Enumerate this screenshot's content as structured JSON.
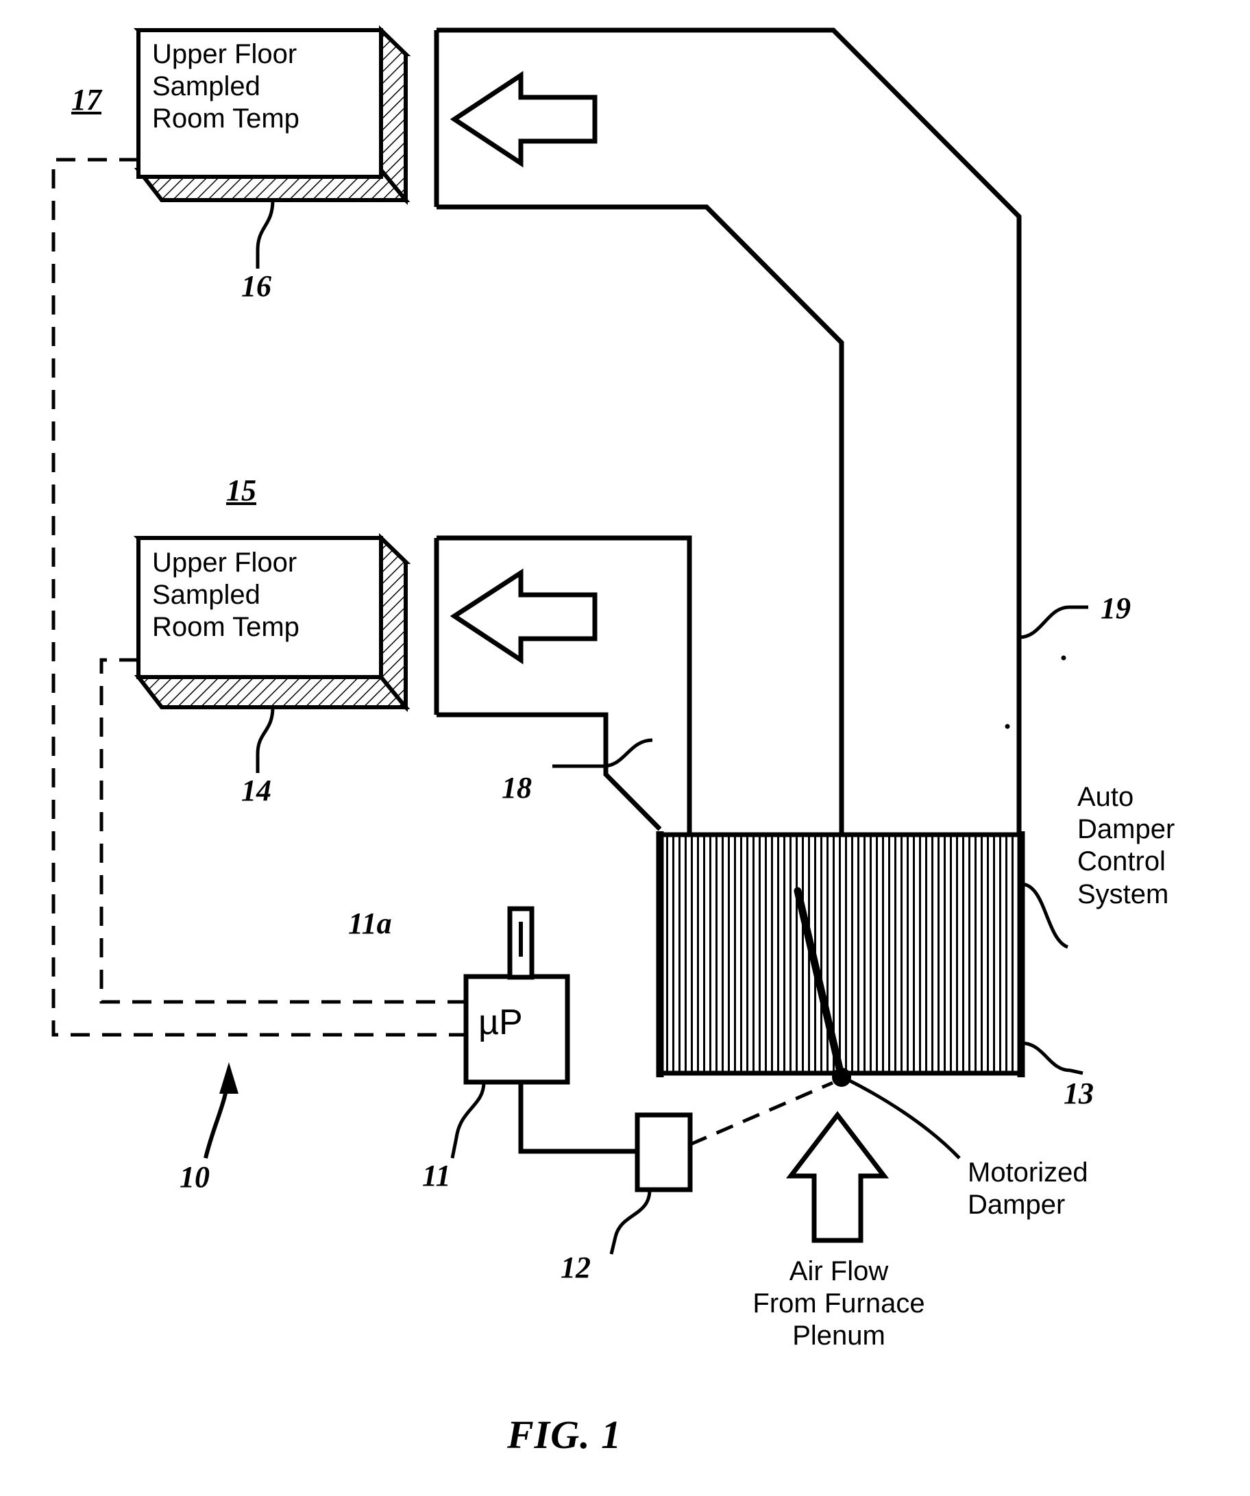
{
  "figure": {
    "caption": "FIG. 1",
    "overall_ref": "10"
  },
  "boxes": {
    "upper_sensor_17": {
      "ref": "17",
      "leader_ref": "16",
      "text": "Upper Floor\nSampled\nRoom Temp"
    },
    "upper_sensor_15": {
      "ref": "15",
      "leader_ref": "14",
      "text": "Upper Floor\nSampled\nRoom Temp"
    },
    "microprocessor": {
      "label": "µP",
      "ref": "11",
      "antenna_ref": "11a"
    },
    "relay": {
      "ref": "12"
    }
  },
  "ducts": {
    "upper_duct_ref": "19",
    "lower_duct_ref": "18",
    "damper_housing_ref": "13"
  },
  "labels": {
    "auto_damper_control_system": "Auto\nDamper\nControl\nSystem",
    "motorized_damper": "Motorized\nDamper",
    "air_flow_from_furnace_plenum": "Air Flow\nFrom Furnace\nPlenum"
  },
  "colors": {
    "line": "#000000",
    "background": "#ffffff",
    "hatch": "#000000"
  }
}
